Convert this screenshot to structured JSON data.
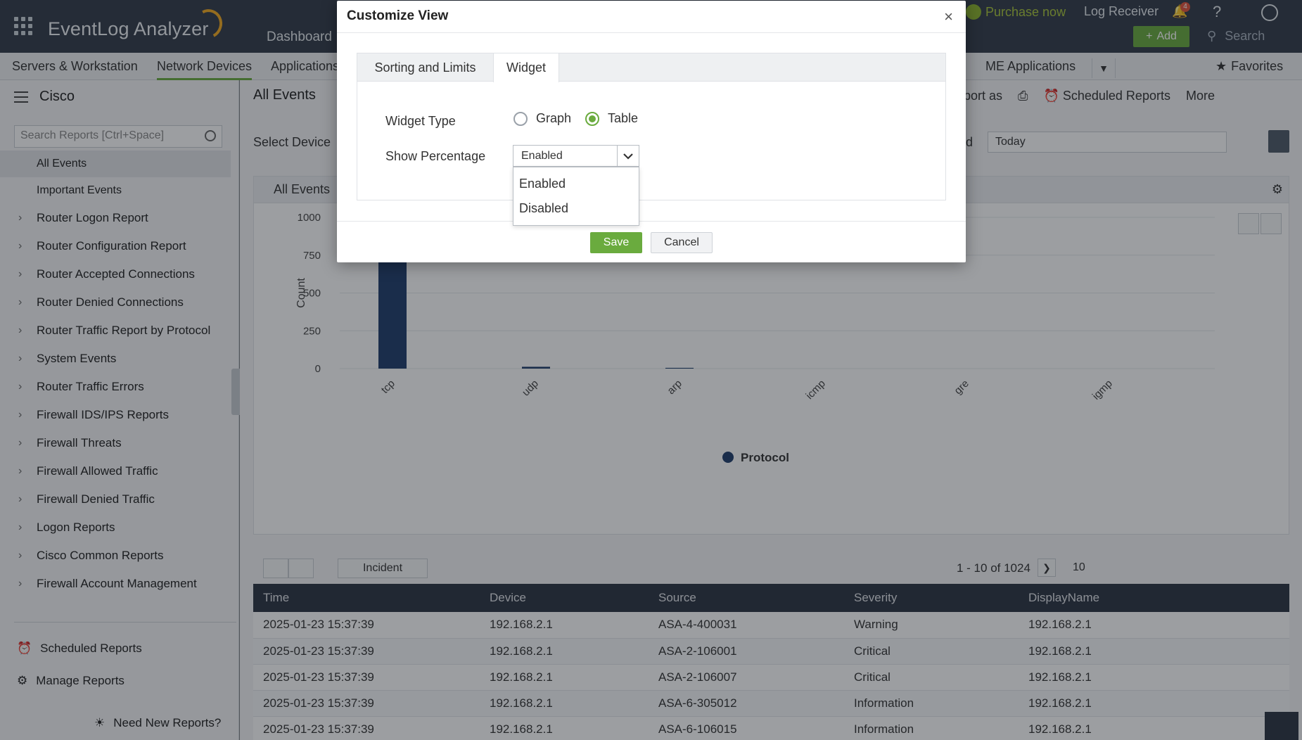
{
  "topbar": {
    "app_name": "EventLog Analyzer",
    "dashboard": "Dashboard",
    "purchase": "Purchase now",
    "log_receiver": "Log Receiver",
    "notification_count": "4",
    "help": "?",
    "add": "Add",
    "search": "Search"
  },
  "nav": {
    "items": [
      "Servers & Workstation",
      "Network Devices",
      "Applications"
    ],
    "me_applications": "ME Applications",
    "favorites": "Favorites"
  },
  "sidebar": {
    "title": "Cisco",
    "search_placeholder": "Search Reports [Ctrl+Space]",
    "sub_items": [
      "All Events",
      "Important Events"
    ],
    "items": [
      "Router Logon Report",
      "Router Configuration Report",
      "Router Accepted Connections",
      "Router Denied Connections",
      "Router Traffic Report by Protocol",
      "System Events",
      "Router Traffic Errors",
      "Firewall IDS/IPS Reports",
      "Firewall Threats",
      "Firewall Allowed Traffic",
      "Firewall Denied Traffic",
      "Logon Reports",
      "Cisco Common Reports",
      "Firewall Account Management"
    ],
    "scheduled_reports": "Scheduled Reports",
    "manage_reports": "Manage Reports",
    "need_new_reports": "Need New Reports?"
  },
  "main": {
    "title": "All Events",
    "export_as": "xport as",
    "scheduled_reports": "Scheduled Reports",
    "more": "More",
    "select_device": "Select Device",
    "period_suffix": "d",
    "date_value": "Today",
    "card_title": "All Events"
  },
  "chart_data": {
    "type": "bar",
    "categories": [
      "tcp",
      "udp",
      "arp",
      "icmp",
      "gre",
      "igmp"
    ],
    "series": [
      {
        "name": "Protocol",
        "values": [
          815,
          12,
          5,
          0,
          0,
          0
        ]
      }
    ],
    "ylabel": "Count",
    "ylim": [
      0,
      1000
    ],
    "yticks": [
      0,
      250,
      500,
      750,
      1000
    ],
    "legend": "bottom-center",
    "bar_color": "#1f3d6b",
    "grid": true
  },
  "table": {
    "incident": "Incident",
    "pager": "1 - 10 of 1024",
    "page_size": "10",
    "columns": [
      "Time",
      "Device",
      "Source",
      "Severity",
      "DisplayName"
    ],
    "rows": [
      [
        "2025-01-23 15:37:39",
        "192.168.2.1",
        "ASA-4-400031",
        "Warning",
        "192.168.2.1"
      ],
      [
        "2025-01-23 15:37:39",
        "192.168.2.1",
        "ASA-2-106001",
        "Critical",
        "192.168.2.1"
      ],
      [
        "2025-01-23 15:37:39",
        "192.168.2.1",
        "ASA-2-106007",
        "Critical",
        "192.168.2.1"
      ],
      [
        "2025-01-23 15:37:39",
        "192.168.2.1",
        "ASA-6-305012",
        "Information",
        "192.168.2.1"
      ],
      [
        "2025-01-23 15:37:39",
        "192.168.2.1",
        "ASA-6-106015",
        "Information",
        "192.168.2.1"
      ]
    ]
  },
  "modal": {
    "title": "Customize View",
    "tabs": [
      "Sorting and Limits",
      "Widget"
    ],
    "widget_type_label": "Widget Type",
    "radio_graph": "Graph",
    "radio_table": "Table",
    "show_percentage_label": "Show Percentage",
    "select_value": "Enabled",
    "options": [
      "Enabled",
      "Disabled"
    ],
    "save": "Save",
    "cancel": "Cancel"
  }
}
